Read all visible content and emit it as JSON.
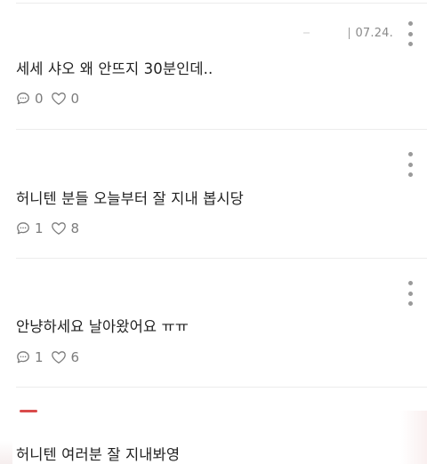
{
  "posts": [
    {
      "date": "07.24.",
      "text": "세세 샤오 왜 안뜨지 30분인데..",
      "comments": "0",
      "likes": "0"
    },
    {
      "text": "허니텐 분들 오늘부터 잘 지내 봅시당",
      "comments": "1",
      "likes": "8"
    },
    {
      "text": "안냥하세요 날아왔어요 ㅠㅠ",
      "comments": "1",
      "likes": "6"
    },
    {
      "text": "허니텐 여러분 잘 지내봐영"
    }
  ],
  "icons": {
    "more": "more-vertical-icon",
    "comment": "comment-bubble-icon",
    "like": "heart-outline-icon"
  },
  "colors": {
    "text": "#222222",
    "meta": "#7c7c7c",
    "divider": "#ececec",
    "accent_red": "#d94b4b"
  }
}
